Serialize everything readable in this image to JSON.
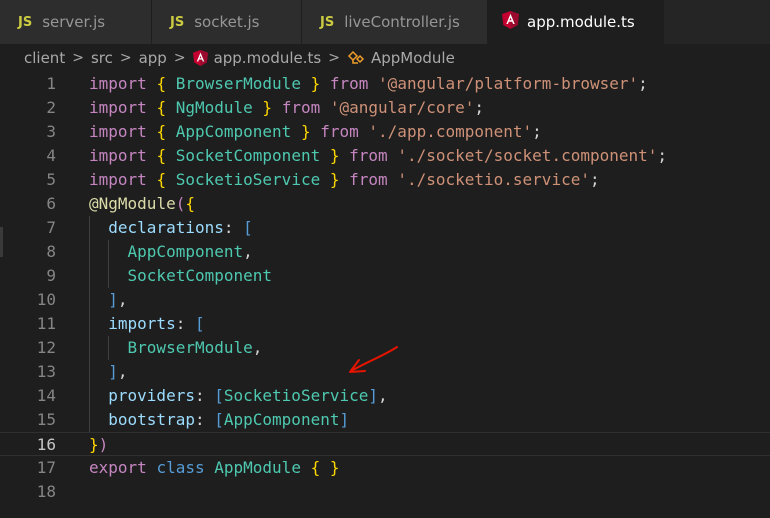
{
  "tabs": [
    {
      "icon": "js-file-icon",
      "badge": "JS",
      "label": "server.js",
      "active": false
    },
    {
      "icon": "js-file-icon",
      "badge": "JS",
      "label": "socket.js",
      "active": false
    },
    {
      "icon": "js-file-icon",
      "badge": "JS",
      "label": "liveController.js",
      "active": false
    },
    {
      "icon": "angular-file-icon",
      "badge": "",
      "label": "app.module.ts",
      "active": true,
      "unsaved": true
    }
  ],
  "breadcrumb": {
    "items": [
      "client",
      "src",
      "app",
      "app.module.ts",
      "AppModule"
    ],
    "separator": ">"
  },
  "editor": {
    "line_numbers": [
      "1",
      "2",
      "3",
      "4",
      "5",
      "6",
      "7",
      "8",
      "9",
      "10",
      "11",
      "12",
      "13",
      "14",
      "15",
      "16",
      "17",
      "18"
    ],
    "current_line": 16,
    "lines": [
      [
        [
          "kw",
          "import"
        ],
        [
          "pun",
          " "
        ],
        [
          "brc",
          "{"
        ],
        [
          "pun",
          " "
        ],
        [
          "cls",
          "BrowserModule"
        ],
        [
          "pun",
          " "
        ],
        [
          "brc",
          "}"
        ],
        [
          "pun",
          " "
        ],
        [
          "kw",
          "from"
        ],
        [
          "pun",
          " "
        ],
        [
          "str",
          "'@angular/platform-browser'"
        ],
        [
          "pun",
          ";"
        ]
      ],
      [
        [
          "kw",
          "import"
        ],
        [
          "pun",
          " "
        ],
        [
          "brc",
          "{"
        ],
        [
          "pun",
          " "
        ],
        [
          "cls",
          "NgModule"
        ],
        [
          "pun",
          " "
        ],
        [
          "brc",
          "}"
        ],
        [
          "pun",
          " "
        ],
        [
          "kw",
          "from"
        ],
        [
          "pun",
          " "
        ],
        [
          "str",
          "'@angular/core'"
        ],
        [
          "pun",
          ";"
        ]
      ],
      [
        [
          "kw",
          "import"
        ],
        [
          "pun",
          " "
        ],
        [
          "brc",
          "{"
        ],
        [
          "pun",
          " "
        ],
        [
          "cls",
          "AppComponent"
        ],
        [
          "pun",
          " "
        ],
        [
          "brc",
          "}"
        ],
        [
          "pun",
          " "
        ],
        [
          "kw",
          "from"
        ],
        [
          "pun",
          " "
        ],
        [
          "str",
          "'./app.component'"
        ],
        [
          "pun",
          ";"
        ]
      ],
      [
        [
          "kw",
          "import"
        ],
        [
          "pun",
          " "
        ],
        [
          "brc",
          "{"
        ],
        [
          "pun",
          " "
        ],
        [
          "cls",
          "SocketComponent"
        ],
        [
          "pun",
          " "
        ],
        [
          "brc",
          "}"
        ],
        [
          "pun",
          " "
        ],
        [
          "kw",
          "from"
        ],
        [
          "pun",
          " "
        ],
        [
          "str",
          "'./socket/socket.component'"
        ],
        [
          "pun",
          ";"
        ]
      ],
      [
        [
          "kw",
          "import"
        ],
        [
          "pun",
          " "
        ],
        [
          "brc",
          "{"
        ],
        [
          "pun",
          " "
        ],
        [
          "cls",
          "SocketioService"
        ],
        [
          "pun",
          " "
        ],
        [
          "brc",
          "}"
        ],
        [
          "pun",
          " "
        ],
        [
          "kw",
          "from"
        ],
        [
          "pun",
          " "
        ],
        [
          "str",
          "'./socketio.service'"
        ],
        [
          "pun",
          ";"
        ]
      ],
      [
        [
          "dec",
          "@"
        ],
        [
          "dec",
          "NgModule"
        ],
        [
          "kw",
          "("
        ],
        [
          "brc",
          "{"
        ]
      ],
      [
        [
          "pun",
          "  "
        ],
        [
          "prp",
          "declarations"
        ],
        [
          "pun",
          ": "
        ],
        [
          "kb",
          "["
        ]
      ],
      [
        [
          "pun",
          "    "
        ],
        [
          "cls",
          "AppComponent"
        ],
        [
          "pun",
          ","
        ]
      ],
      [
        [
          "pun",
          "    "
        ],
        [
          "cls",
          "SocketComponent"
        ]
      ],
      [
        [
          "pun",
          "  "
        ],
        [
          "kb",
          "]"
        ],
        [
          "pun",
          ","
        ]
      ],
      [
        [
          "pun",
          "  "
        ],
        [
          "prp",
          "imports"
        ],
        [
          "pun",
          ": "
        ],
        [
          "kb",
          "["
        ]
      ],
      [
        [
          "pun",
          "    "
        ],
        [
          "cls",
          "BrowserModule"
        ],
        [
          "pun",
          ","
        ]
      ],
      [
        [
          "pun",
          "  "
        ],
        [
          "kb",
          "]"
        ],
        [
          "pun",
          ","
        ]
      ],
      [
        [
          "pun",
          "  "
        ],
        [
          "prp",
          "providers"
        ],
        [
          "pun",
          ": "
        ],
        [
          "kb",
          "["
        ],
        [
          "cls",
          "SocketioService"
        ],
        [
          "kb",
          "]"
        ],
        [
          "pun",
          ","
        ]
      ],
      [
        [
          "pun",
          "  "
        ],
        [
          "prp",
          "bootstrap"
        ],
        [
          "pun",
          ": "
        ],
        [
          "kb",
          "["
        ],
        [
          "cls",
          "AppComponent"
        ],
        [
          "kb",
          "]"
        ]
      ],
      [
        [
          "brc",
          "}"
        ],
        [
          "kw",
          ")"
        ]
      ],
      [
        [
          "kw",
          "export"
        ],
        [
          "pun",
          " "
        ],
        [
          "kb",
          "class"
        ],
        [
          "pun",
          " "
        ],
        [
          "cls",
          "AppModule"
        ],
        [
          "pun",
          " "
        ],
        [
          "brc",
          "{"
        ],
        [
          "pun",
          " "
        ],
        [
          "brc",
          "}"
        ]
      ],
      []
    ]
  },
  "colors": {
    "background": "#1e1e1e",
    "keyword": "#c586c0",
    "storage": "#569cd6",
    "type": "#4ec9b0",
    "string": "#ce9178",
    "property": "#9cdcfe",
    "bracket": "#ffd700",
    "annotation_arrow": "#e51400"
  }
}
